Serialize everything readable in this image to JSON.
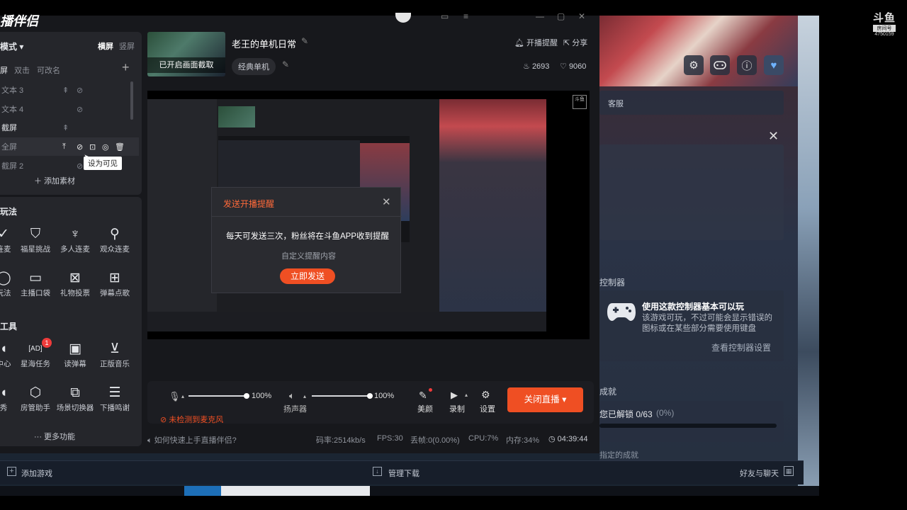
{
  "watermark": {
    "brand": "斗鱼",
    "sub": "房间号",
    "room_id": "4750159"
  },
  "obs": {
    "app_title": "播伴侣",
    "mode_label": "模式",
    "orient_h": "横屏",
    "orient_v": "竖屏",
    "scene_tabs": [
      "屏",
      "双击",
      "可改名"
    ],
    "sources": [
      {
        "label": "文本 3"
      },
      {
        "label": "文本 4"
      },
      {
        "label": "截屏"
      },
      {
        "label": "全屏"
      },
      {
        "label": "截屏 2"
      }
    ],
    "tooltip": "设为可见",
    "add_material": "添加素材",
    "section_play": "玩法",
    "play_tools": [
      "连麦",
      "福星挑战",
      "多人连麦",
      "观众连麦",
      "玩法",
      "主播口袋",
      "礼物投票",
      "弹幕点歌"
    ],
    "section_tools": "工具",
    "tools": [
      "中心",
      "星海任务",
      "读弹幕",
      "正版音乐",
      "秀",
      "房管助手",
      "场景切换器",
      "下播鸣谢"
    ],
    "tools_badge": "1",
    "more": "更多功能",
    "thumb_label": "已开启画面截取",
    "room_title": "老王的单机日常",
    "category": "经典单机",
    "reminder": "开播提醒",
    "share": "分享",
    "hot_count": "2693",
    "like_count": "9060",
    "mic_pct": "100%",
    "speaker_pct": "100%",
    "speaker_label": "扬声器",
    "mic_warning": "未检测到麦克风",
    "beauty": "美颜",
    "record": "录制",
    "settings": "设置",
    "close_live": "关闭直播",
    "help_link": "如何快速上手直播伴侣?",
    "bitrate": "码率:2514kb/s",
    "fps": "FPS:30",
    "drop": "丢帧:0(0.00%)",
    "cpu": "CPU:7%",
    "mem": "内存:34%",
    "time": "04:39:44"
  },
  "dialog": {
    "title": "发送开播提醒",
    "message": "每天可发送三次，粉丝将在斗鱼APP收到提醒",
    "custom": "自定义提醒内容",
    "send": "立即发送"
  },
  "steam": {
    "kefu": "客服",
    "controller_section": "控制器",
    "controller_title": "使用这款控制器基本可以玩",
    "controller_desc": "该游戏可玩，不过可能会显示错误的图标或在某些部分需要使用键盘",
    "controller_link": "查看控制器设置",
    "achievements_section": "成就",
    "achievements": "您已解锁 0/63",
    "achievements_pct": "(0%)",
    "next_label": "指定的成就",
    "add_game": "添加游戏",
    "manage_downloads": "管理下载",
    "friends_chat": "好友与聊天"
  }
}
